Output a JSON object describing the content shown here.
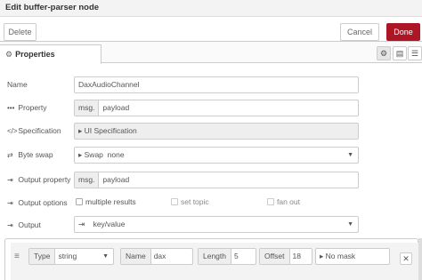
{
  "dialog": {
    "title": "Edit buffer-parser node",
    "delete_label": "Delete",
    "cancel_label": "Cancel",
    "done_label": "Done"
  },
  "tabs": {
    "properties_label": "Properties",
    "properties_icon": "⚙"
  },
  "form": {
    "name": {
      "label": "Name",
      "value": "DaxAudioChannel"
    },
    "property": {
      "label": "Property",
      "prefix": "msg.",
      "value": "payload"
    },
    "specification": {
      "label": "Specification",
      "prefix": "UI Specification"
    },
    "byte_swap": {
      "label": "Byte swap",
      "prefix": "Swap",
      "value": "none"
    },
    "output_property": {
      "label": "Output property",
      "prefix": "msg.",
      "value": "payload"
    },
    "output_options": {
      "label": "Output options",
      "multiple_results": "multiple results",
      "set_topic": "set topic",
      "fan_out": "fan out"
    },
    "output": {
      "label": "Output",
      "value": "key/value"
    }
  },
  "list": {
    "row": {
      "type_label": "Type",
      "type_value": "string",
      "name_label": "Name",
      "name_value": "dax",
      "length_label": "Length",
      "length_value": "5",
      "offset_label": "Offset",
      "offset_value": "18",
      "mask_value": "No mask"
    }
  }
}
